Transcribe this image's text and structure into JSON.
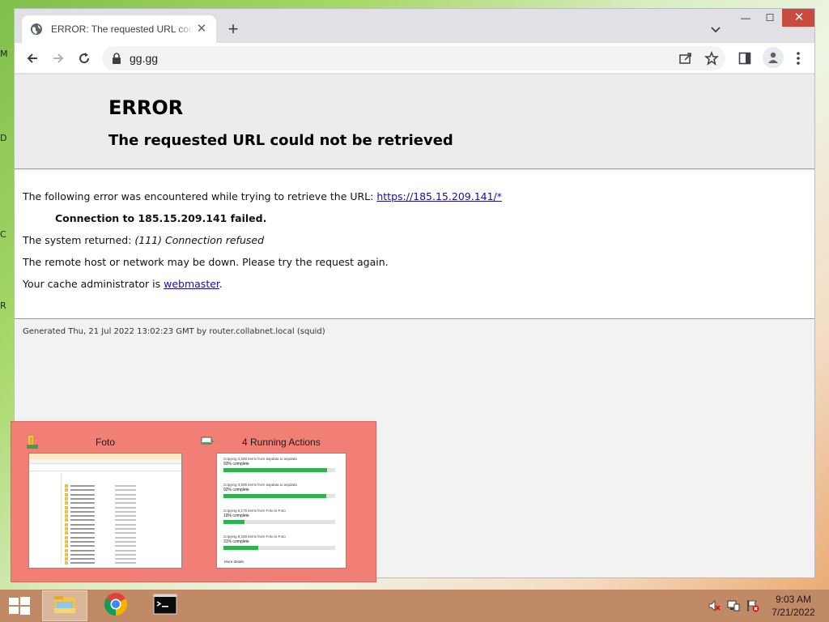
{
  "desktop": {
    "edge_letters": [
      "M",
      "D",
      "C",
      "R"
    ]
  },
  "browser": {
    "tab": {
      "title": "ERROR: The requested URL could not be retrieved"
    },
    "new_tab_label": "+",
    "window_controls": {
      "minimize": "—",
      "maximize": "☐",
      "close": "✕"
    },
    "address_bar": {
      "url": "gg.gg"
    }
  },
  "page": {
    "heading": "ERROR",
    "subheading": "The requested URL could not be retrieved",
    "line1_text": "The following error was encountered while trying to retrieve the URL: ",
    "line1_link": "https://185.15.209.141/*",
    "line2": "Connection to 185.15.209.141 failed.",
    "line3_text": "The system returned: ",
    "line3_italic": "(111) Connection refused",
    "line4": "The remote host or network may be down. Please try the request again.",
    "line5_text": "Your cache administrator is ",
    "line5_link": "webmaster",
    "line5_end": ".",
    "footer": "Generated Thu, 21 Jul 2022 13:02:23 GMT by router.collabnet.local (squid)"
  },
  "thumbnails": {
    "explorer": {
      "title": "Foto"
    },
    "actions": {
      "title": "4 Running Actions",
      "items": [
        {
          "label": "Copying 2,838 items from aspdata to aspdata",
          "percent_text": "93% complete",
          "progress": 0.93
        },
        {
          "label": "Copying 3,935 items from aspdata to aspdata",
          "percent_text": "92% complete",
          "progress": 0.92
        },
        {
          "label": "Copying 6,175 items from Foto to Foto",
          "percent_text": "19% complete",
          "progress": 0.19
        },
        {
          "label": "Copying 8,339 items from Foto to Foto",
          "percent_text": "31% complete",
          "progress": 0.31
        }
      ],
      "more_details": "More details"
    }
  },
  "taskbar": {
    "apps": [
      "file-explorer",
      "chrome",
      "command-prompt"
    ],
    "clock": {
      "time": "9:03 AM",
      "date": "7/21/2022"
    }
  },
  "colors": {
    "popup_bg": "#f27f75",
    "taskbar_bg": "#c08a66",
    "link": "#1a0dab",
    "progress_green": "#2eb24a"
  }
}
